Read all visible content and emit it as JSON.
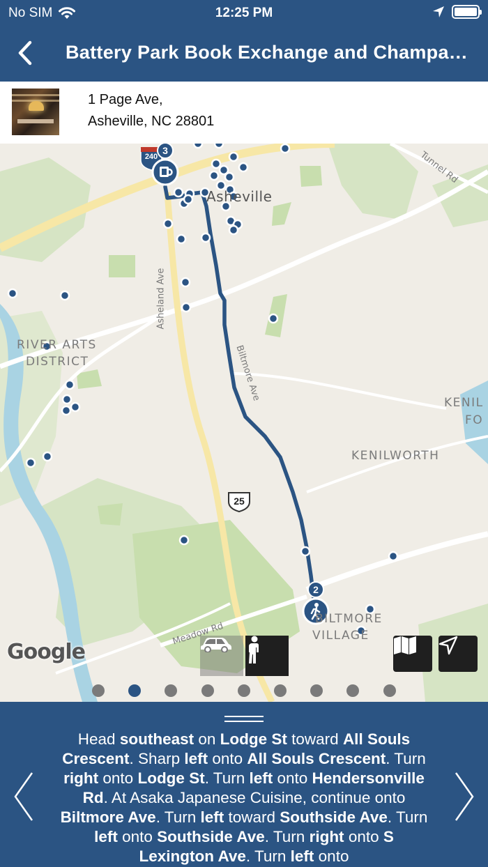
{
  "status_bar": {
    "carrier": "No SIM",
    "time": "12:25 PM"
  },
  "nav": {
    "title": "Battery Park Book Exchange and Champag..."
  },
  "place": {
    "address_line1": "1 Page Ave,",
    "address_line2": "Asheville, NC 28801"
  },
  "map": {
    "labels": {
      "asheville": "Asheville",
      "river_arts_1": "RIVER ARTS",
      "river_arts_2": "DISTRICT",
      "kenilworth": "KENILWORTH",
      "kenil": "KENIL",
      "fo": "FO",
      "biltmore_village_1": "BILTMORE",
      "biltmore_village_2": "VILLAGE",
      "asheland_ave": "Asheland Ave",
      "biltmore_ave": "Biltmore Ave",
      "tunnel_rd": "Tunnel Rd",
      "meadow_rd": "Meadow Rd",
      "interstate": "240",
      "us_route": "25"
    },
    "markers": {
      "start_number": "3",
      "end_number": "2"
    },
    "attribution": "Google",
    "colors": {
      "route": "#2b5483",
      "marker": "#2b5483",
      "park": "#c8deae"
    }
  },
  "modes": {
    "car_icon": "car-icon",
    "walk_icon": "walk-icon",
    "selected": "walk"
  },
  "pager": {
    "count": 9,
    "active_index": 1
  },
  "directions": {
    "segments": [
      [
        "Head ",
        false
      ],
      [
        "southeast",
        true
      ],
      [
        " on ",
        false
      ],
      [
        "Lodge St",
        true
      ],
      [
        " toward ",
        false
      ],
      [
        "All Souls Crescent",
        true
      ],
      [
        ". Sharp ",
        false
      ],
      [
        "left",
        true
      ],
      [
        " onto ",
        false
      ],
      [
        "All Souls Crescent",
        true
      ],
      [
        ". Turn ",
        false
      ],
      [
        "right",
        true
      ],
      [
        " onto ",
        false
      ],
      [
        "Lodge St",
        true
      ],
      [
        ". Turn ",
        false
      ],
      [
        "left",
        true
      ],
      [
        " onto ",
        false
      ],
      [
        "Hendersonville Rd",
        true
      ],
      [
        ". At Asaka Japanese Cuisine, continue onto ",
        false
      ],
      [
        "Biltmore Ave",
        true
      ],
      [
        ". Turn ",
        false
      ],
      [
        "left",
        true
      ],
      [
        " toward ",
        false
      ],
      [
        "Southside Ave",
        true
      ],
      [
        ". Turn ",
        false
      ],
      [
        "left",
        true
      ],
      [
        " onto ",
        false
      ],
      [
        "Southside Ave",
        true
      ],
      [
        ". Turn ",
        false
      ],
      [
        "right",
        true
      ],
      [
        " onto ",
        false
      ],
      [
        "S Lexington Ave",
        true
      ],
      [
        ". Turn ",
        false
      ],
      [
        "left",
        true
      ],
      [
        " onto",
        false
      ]
    ]
  },
  "theme": {
    "primary": "#2b5483"
  }
}
